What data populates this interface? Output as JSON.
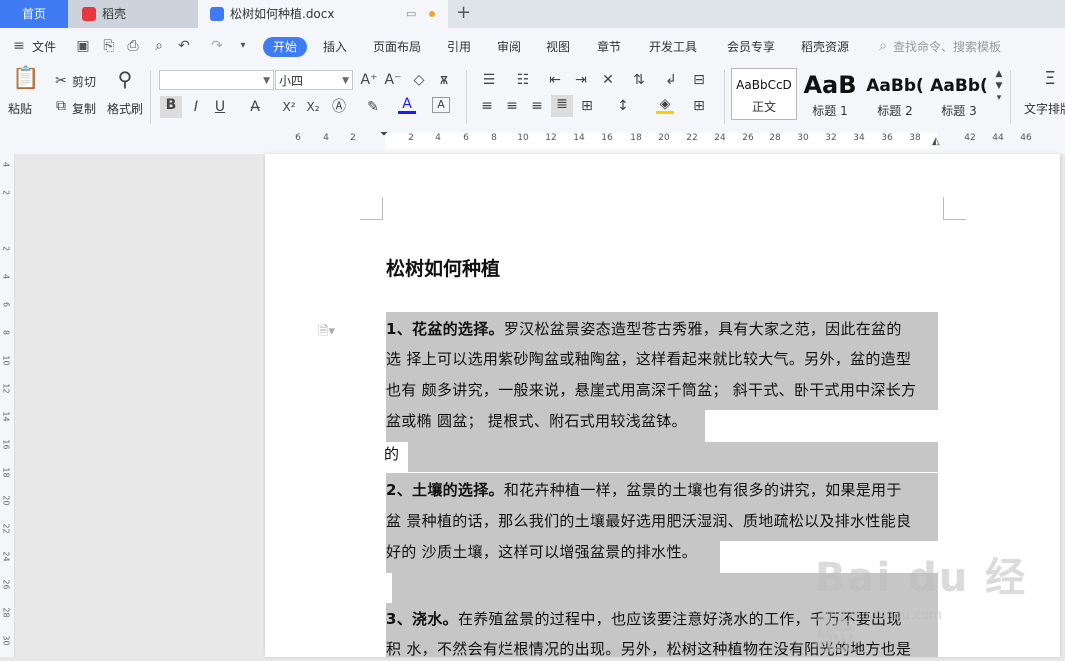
{
  "tabs": {
    "home": "首页",
    "docer": "稻壳",
    "document": "松树如何种植.docx",
    "add": "+"
  },
  "menu": {
    "file": "文件",
    "items": [
      "开始",
      "插入",
      "页面布局",
      "引用",
      "审阅",
      "视图",
      "章节",
      "开发工具",
      "会员专享",
      "稻壳资源"
    ],
    "search_placeholder": "查找命令、搜索模板"
  },
  "ribbon": {
    "paste": "粘贴",
    "cut": "剪切",
    "copy": "复制",
    "format_painter": "格式刷",
    "font_name": "",
    "font_size": "小四",
    "styles": [
      {
        "preview": "AaBbCcD",
        "name": "正文"
      },
      {
        "preview": "AaB",
        "name": "标题 1"
      },
      {
        "preview": "AaBb(",
        "name": "标题 2"
      },
      {
        "preview": "AaBb(",
        "name": "标题 3"
      }
    ],
    "text_layout": "文字排版"
  },
  "ruler_top": [
    "6",
    "4",
    "2",
    "2",
    "4",
    "6",
    "8",
    "10",
    "12",
    "14",
    "16",
    "18",
    "20",
    "22",
    "24",
    "26",
    "28",
    "30",
    "32",
    "34",
    "36",
    "38",
    "42",
    "44",
    "46"
  ],
  "ruler_left": [
    "4",
    "2",
    "2",
    "4",
    "6",
    "8",
    "10",
    "12",
    "14",
    "16",
    "18",
    "20",
    "22",
    "24",
    "26",
    "28",
    "30"
  ],
  "document": {
    "title": "松树如何种植",
    "lines": [
      "1、花盆的选择。罗汉松盆景姿态造型苍古秀雅，具有大家之范，因此在盆的",
      "选  择上可以选用紫砂陶盆或釉陶盆，这样看起来就比较大气。另外，盆的造型",
      "也有  颇多讲究，一般来说，悬崖式用高深千筒盆；   斜干式、卧干式用中深长方",
      "盆或椭  圆盆；  提根式、附石式用较浅盆钵。",
      "的",
      "2、土壤的选择。和花卉种植一样，盆景的土壤也有很多的讲究，如果是用于",
      "盆  景种植的话，那么我们的土壤最好选用肥沃湿润、质地疏松以及排水性能良",
      "好的  沙质土壤，这样可以增强盆景的排水性。",
      "",
      "3、浇水。在养殖盆景的过程中，也应该要注意好浇水的工作，千万不要出现",
      "积  水，不然会有烂根情况的出现。另外，松树这种植物在没有阳光的地方也是"
    ]
  },
  "watermark": {
    "main": "Bai du 经验",
    "sub": "jingyan.baidu.com"
  },
  "colors": {
    "accent": "#3f7cf4",
    "highlight": "#c6c6c6"
  }
}
